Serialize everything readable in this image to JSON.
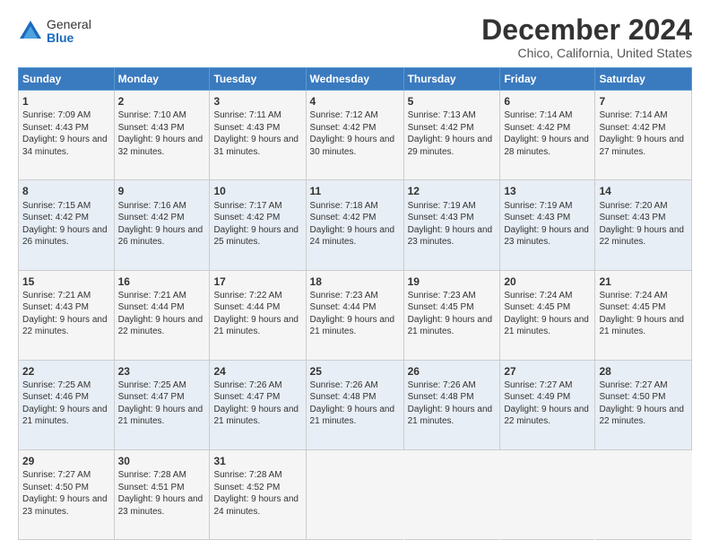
{
  "logo": {
    "general": "General",
    "blue": "Blue"
  },
  "title": "December 2024",
  "subtitle": "Chico, California, United States",
  "days_of_week": [
    "Sunday",
    "Monday",
    "Tuesday",
    "Wednesday",
    "Thursday",
    "Friday",
    "Saturday"
  ],
  "weeks": [
    [
      {
        "day": "1",
        "sunrise": "Sunrise: 7:09 AM",
        "sunset": "Sunset: 4:43 PM",
        "daylight": "Daylight: 9 hours and 34 minutes."
      },
      {
        "day": "2",
        "sunrise": "Sunrise: 7:10 AM",
        "sunset": "Sunset: 4:43 PM",
        "daylight": "Daylight: 9 hours and 32 minutes."
      },
      {
        "day": "3",
        "sunrise": "Sunrise: 7:11 AM",
        "sunset": "Sunset: 4:43 PM",
        "daylight": "Daylight: 9 hours and 31 minutes."
      },
      {
        "day": "4",
        "sunrise": "Sunrise: 7:12 AM",
        "sunset": "Sunset: 4:42 PM",
        "daylight": "Daylight: 9 hours and 30 minutes."
      },
      {
        "day": "5",
        "sunrise": "Sunrise: 7:13 AM",
        "sunset": "Sunset: 4:42 PM",
        "daylight": "Daylight: 9 hours and 29 minutes."
      },
      {
        "day": "6",
        "sunrise": "Sunrise: 7:14 AM",
        "sunset": "Sunset: 4:42 PM",
        "daylight": "Daylight: 9 hours and 28 minutes."
      },
      {
        "day": "7",
        "sunrise": "Sunrise: 7:14 AM",
        "sunset": "Sunset: 4:42 PM",
        "daylight": "Daylight: 9 hours and 27 minutes."
      }
    ],
    [
      {
        "day": "8",
        "sunrise": "Sunrise: 7:15 AM",
        "sunset": "Sunset: 4:42 PM",
        "daylight": "Daylight: 9 hours and 26 minutes."
      },
      {
        "day": "9",
        "sunrise": "Sunrise: 7:16 AM",
        "sunset": "Sunset: 4:42 PM",
        "daylight": "Daylight: 9 hours and 26 minutes."
      },
      {
        "day": "10",
        "sunrise": "Sunrise: 7:17 AM",
        "sunset": "Sunset: 4:42 PM",
        "daylight": "Daylight: 9 hours and 25 minutes."
      },
      {
        "day": "11",
        "sunrise": "Sunrise: 7:18 AM",
        "sunset": "Sunset: 4:42 PM",
        "daylight": "Daylight: 9 hours and 24 minutes."
      },
      {
        "day": "12",
        "sunrise": "Sunrise: 7:19 AM",
        "sunset": "Sunset: 4:43 PM",
        "daylight": "Daylight: 9 hours and 23 minutes."
      },
      {
        "day": "13",
        "sunrise": "Sunrise: 7:19 AM",
        "sunset": "Sunset: 4:43 PM",
        "daylight": "Daylight: 9 hours and 23 minutes."
      },
      {
        "day": "14",
        "sunrise": "Sunrise: 7:20 AM",
        "sunset": "Sunset: 4:43 PM",
        "daylight": "Daylight: 9 hours and 22 minutes."
      }
    ],
    [
      {
        "day": "15",
        "sunrise": "Sunrise: 7:21 AM",
        "sunset": "Sunset: 4:43 PM",
        "daylight": "Daylight: 9 hours and 22 minutes."
      },
      {
        "day": "16",
        "sunrise": "Sunrise: 7:21 AM",
        "sunset": "Sunset: 4:44 PM",
        "daylight": "Daylight: 9 hours and 22 minutes."
      },
      {
        "day": "17",
        "sunrise": "Sunrise: 7:22 AM",
        "sunset": "Sunset: 4:44 PM",
        "daylight": "Daylight: 9 hours and 21 minutes."
      },
      {
        "day": "18",
        "sunrise": "Sunrise: 7:23 AM",
        "sunset": "Sunset: 4:44 PM",
        "daylight": "Daylight: 9 hours and 21 minutes."
      },
      {
        "day": "19",
        "sunrise": "Sunrise: 7:23 AM",
        "sunset": "Sunset: 4:45 PM",
        "daylight": "Daylight: 9 hours and 21 minutes."
      },
      {
        "day": "20",
        "sunrise": "Sunrise: 7:24 AM",
        "sunset": "Sunset: 4:45 PM",
        "daylight": "Daylight: 9 hours and 21 minutes."
      },
      {
        "day": "21",
        "sunrise": "Sunrise: 7:24 AM",
        "sunset": "Sunset: 4:45 PM",
        "daylight": "Daylight: 9 hours and 21 minutes."
      }
    ],
    [
      {
        "day": "22",
        "sunrise": "Sunrise: 7:25 AM",
        "sunset": "Sunset: 4:46 PM",
        "daylight": "Daylight: 9 hours and 21 minutes."
      },
      {
        "day": "23",
        "sunrise": "Sunrise: 7:25 AM",
        "sunset": "Sunset: 4:47 PM",
        "daylight": "Daylight: 9 hours and 21 minutes."
      },
      {
        "day": "24",
        "sunrise": "Sunrise: 7:26 AM",
        "sunset": "Sunset: 4:47 PM",
        "daylight": "Daylight: 9 hours and 21 minutes."
      },
      {
        "day": "25",
        "sunrise": "Sunrise: 7:26 AM",
        "sunset": "Sunset: 4:48 PM",
        "daylight": "Daylight: 9 hours and 21 minutes."
      },
      {
        "day": "26",
        "sunrise": "Sunrise: 7:26 AM",
        "sunset": "Sunset: 4:48 PM",
        "daylight": "Daylight: 9 hours and 21 minutes."
      },
      {
        "day": "27",
        "sunrise": "Sunrise: 7:27 AM",
        "sunset": "Sunset: 4:49 PM",
        "daylight": "Daylight: 9 hours and 22 minutes."
      },
      {
        "day": "28",
        "sunrise": "Sunrise: 7:27 AM",
        "sunset": "Sunset: 4:50 PM",
        "daylight": "Daylight: 9 hours and 22 minutes."
      }
    ],
    [
      {
        "day": "29",
        "sunrise": "Sunrise: 7:27 AM",
        "sunset": "Sunset: 4:50 PM",
        "daylight": "Daylight: 9 hours and 23 minutes."
      },
      {
        "day": "30",
        "sunrise": "Sunrise: 7:28 AM",
        "sunset": "Sunset: 4:51 PM",
        "daylight": "Daylight: 9 hours and 23 minutes."
      },
      {
        "day": "31",
        "sunrise": "Sunrise: 7:28 AM",
        "sunset": "Sunset: 4:52 PM",
        "daylight": "Daylight: 9 hours and 24 minutes."
      },
      null,
      null,
      null,
      null
    ]
  ]
}
